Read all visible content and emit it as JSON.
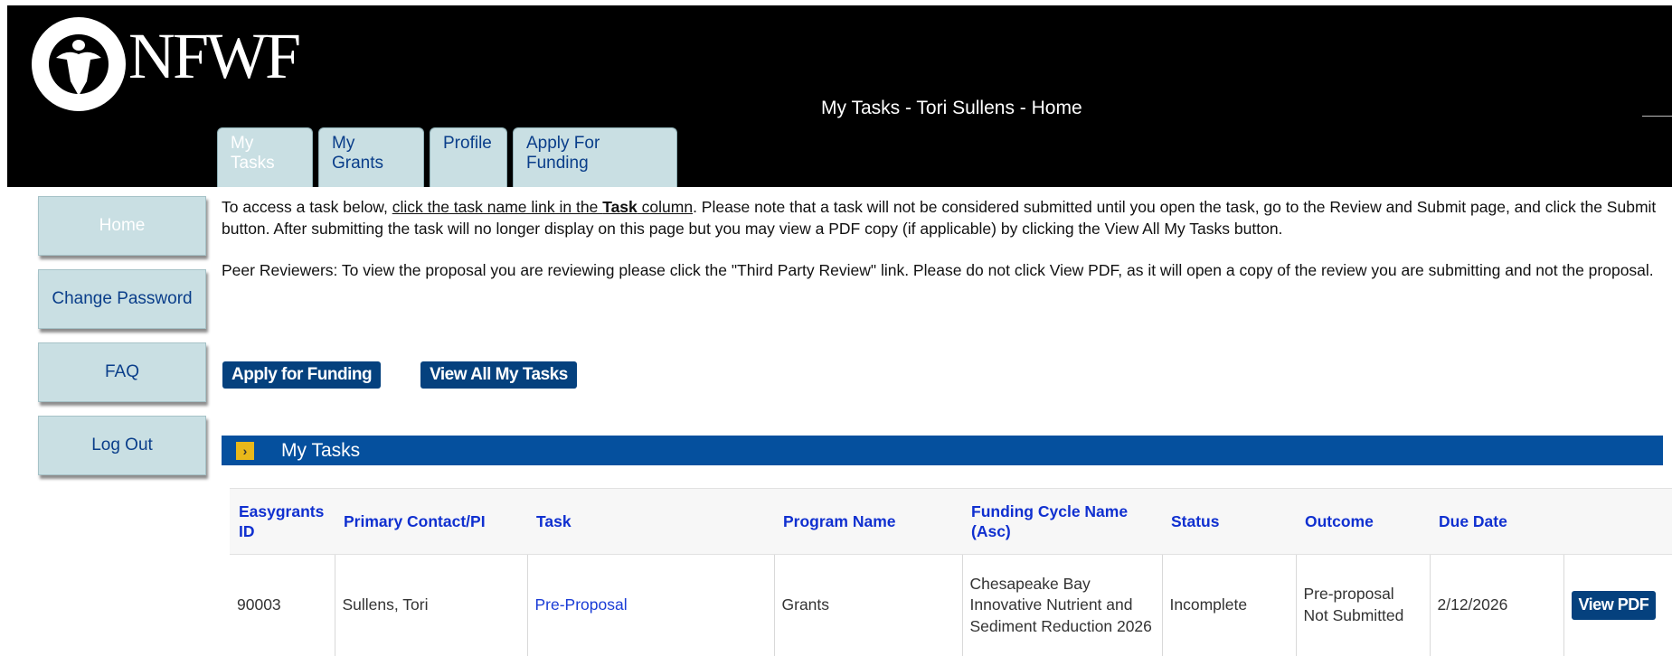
{
  "brand": {
    "logo_text": "NFWF"
  },
  "header": {
    "title": "My Tasks  -  Tori  Sullens  -  Home"
  },
  "tabs": [
    {
      "label": "My Tasks",
      "active": true
    },
    {
      "label": "My Grants"
    },
    {
      "label": "Profile"
    },
    {
      "label": "Apply For Funding"
    }
  ],
  "sidebar": {
    "items": [
      {
        "label": "Home",
        "active": true
      },
      {
        "label": "Change Password"
      },
      {
        "label": "FAQ"
      },
      {
        "label": "Log Out"
      }
    ]
  },
  "instructions": {
    "p1_pre": "To access a task below, ",
    "p1_link_a": "click the task name link in the ",
    "p1_link_b": "Task",
    "p1_link_c": " column",
    "p1_post": ". Please note that a task will not be considered submitted until you open the task, go to the Review and Submit page, and click the Submit button. After submitting the task will no longer display on this page but you may view a PDF copy (if applicable) by clicking the View All My Tasks button.",
    "p2": "Peer Reviewers: To view the proposal you are reviewing please click the \"Third Party Review\" link. Please do not click View PDF, as it will open a copy of the review you are submitting and not the proposal."
  },
  "actions": {
    "apply_label": "Apply for Funding",
    "view_all_label": "View All My Tasks"
  },
  "section": {
    "title": "My Tasks",
    "toggle": "›"
  },
  "table": {
    "columns": [
      "Easygrants ID",
      "Primary Contact/PI",
      "Task",
      "Program Name",
      "Funding Cycle Name (Asc)",
      "Status",
      "Outcome",
      "Due Date",
      ""
    ],
    "rows": [
      {
        "id": "90003",
        "contact": "Sullens, Tori",
        "task": "Pre-Proposal",
        "program": "Grants",
        "cycle": "Chesapeake Bay Innovative Nutrient and Sediment Reduction 2026",
        "status": "Incomplete",
        "outcome": "Pre-proposal Not Submitted",
        "due": "2/12/2026",
        "action": "View PDF"
      }
    ]
  },
  "colors": {
    "header_bg": "#000000",
    "tab_bg": "#c9dfe3",
    "link": "#0a3e8a",
    "button_bg": "#05417e",
    "section_bar": "#05509e",
    "toggle": "#e8b81a"
  }
}
